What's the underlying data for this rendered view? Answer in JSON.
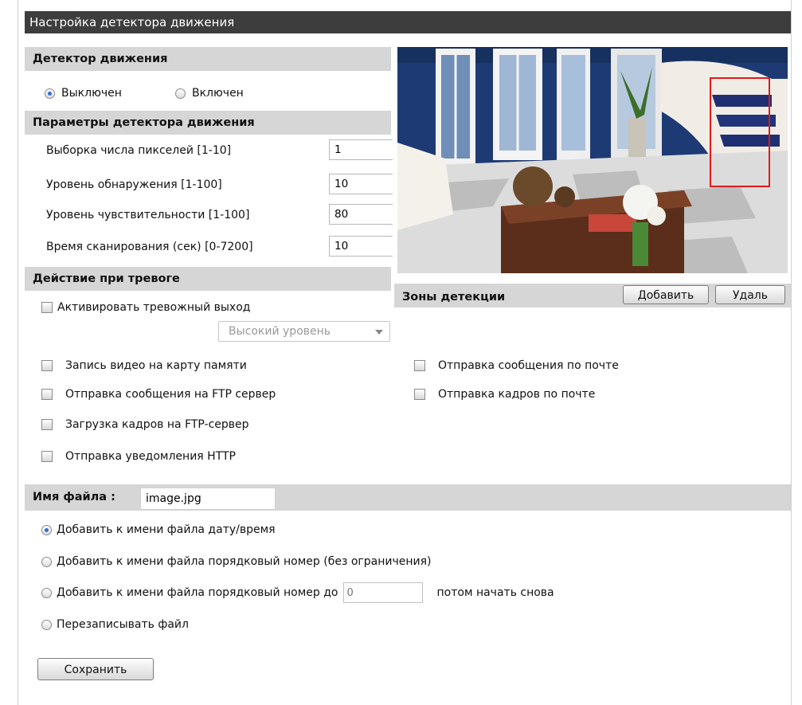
{
  "title": "Настройка детектора движения",
  "motion_detector": {
    "header": "Детектор движения",
    "options": [
      {
        "label": "Выключен",
        "checked": true
      },
      {
        "label": "Включен",
        "checked": false
      }
    ]
  },
  "params": {
    "header": "Параметры детектора движения",
    "rows": [
      {
        "label": "Выборка числа пикселей [1-10]",
        "value": "1"
      },
      {
        "label": "Уровень обнаружения [1-100]",
        "value": "10"
      },
      {
        "label": "Уровень чувствительности [1-100]",
        "value": "80"
      },
      {
        "label": "Время сканирования (сек) [0-7200]",
        "value": "10"
      }
    ]
  },
  "alarm": {
    "header": "Действие при тревоге",
    "activate_output": "Активировать тревожный выход",
    "level_select": "Высокий уровень",
    "actions_left": [
      "Запись видео на карту памяти",
      "Отправка сообщения на FTP сервер",
      "Загрузка кадров на FTP-сервер",
      "Отправка уведомления HTTP"
    ],
    "actions_right": [
      "Отправка сообщения по почте",
      "Отправка кадров по почте"
    ]
  },
  "zones": {
    "label": "Зоны детекции",
    "add_button": "Добавить",
    "delete_button": "Удаль"
  },
  "filename": {
    "label": "Имя файла :",
    "value": "image.jpg",
    "options": [
      {
        "label": "Добавить к имени файла дату/время",
        "checked": true
      },
      {
        "label": "Добавить к имени файла порядковый номер (без ограничения)",
        "checked": false
      },
      {
        "label": "Добавить к имени файла порядковый номер до",
        "checked": false,
        "input_placeholder": "0",
        "suffix": "потом начать снова"
      },
      {
        "label": "Перезаписывать файл",
        "checked": false
      }
    ]
  },
  "save_button": "Сохранить"
}
